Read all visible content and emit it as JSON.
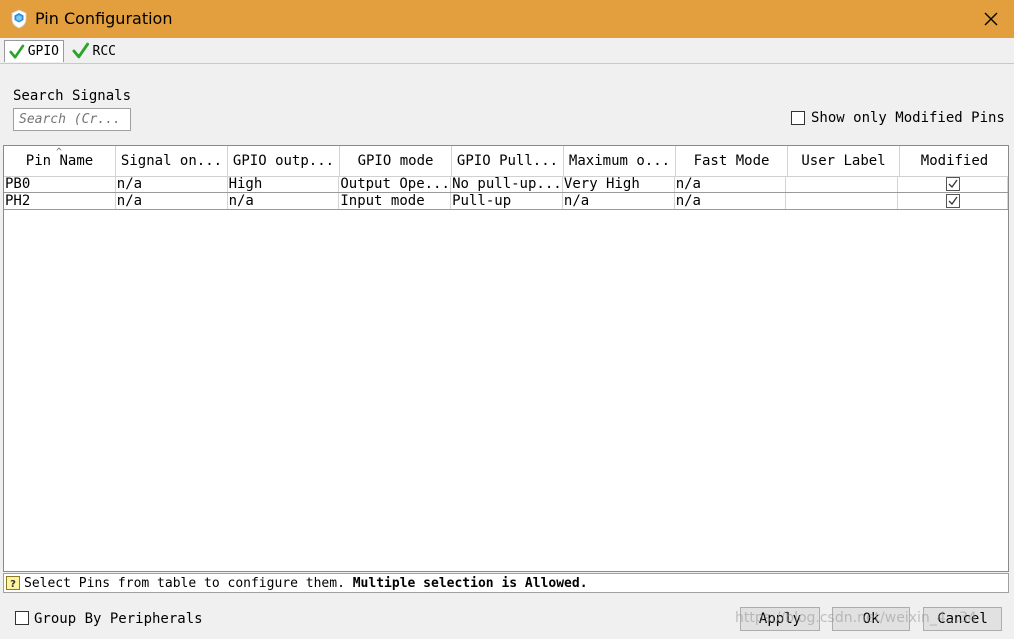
{
  "window": {
    "title": "Pin Configuration",
    "title_bar_color": "#e39f3d"
  },
  "tabs": [
    {
      "label": "GPIO",
      "icon": "green-check-icon",
      "active": true
    },
    {
      "label": "RCC",
      "icon": "green-check-icon",
      "active": false
    }
  ],
  "search": {
    "label": "Search Signals",
    "placeholder": "Search (Cr..."
  },
  "filter": {
    "show_modified_label": "Show only Modified Pins",
    "checked": false
  },
  "table": {
    "columns": [
      "Pin Name",
      "Signal on...",
      "GPIO outp...",
      "GPIO mode",
      "GPIO Pull...",
      "Maximum o...",
      "Fast Mode",
      "User Label",
      "Modified"
    ],
    "rows": [
      [
        "PB0",
        "n/a",
        "High",
        "Output Ope...",
        "No pull-up...",
        "Very High",
        "n/a",
        "",
        ""
      ],
      [
        "PH2",
        "n/a",
        "n/a",
        "Input mode",
        "Pull-up",
        "n/a",
        "n/a",
        "",
        ""
      ]
    ],
    "modified": [
      true,
      true
    ]
  },
  "status": {
    "prefix": "Select Pins from table to configure them. ",
    "bold": "Multiple selection is Allowed."
  },
  "footer": {
    "group_label": "Group By Peripherals",
    "group_checked": false,
    "buttons": {
      "apply": "Apply",
      "ok": "Ok",
      "cancel": "Cancel"
    }
  },
  "watermark": "https://blog.csdn.net/weixin_4...34"
}
